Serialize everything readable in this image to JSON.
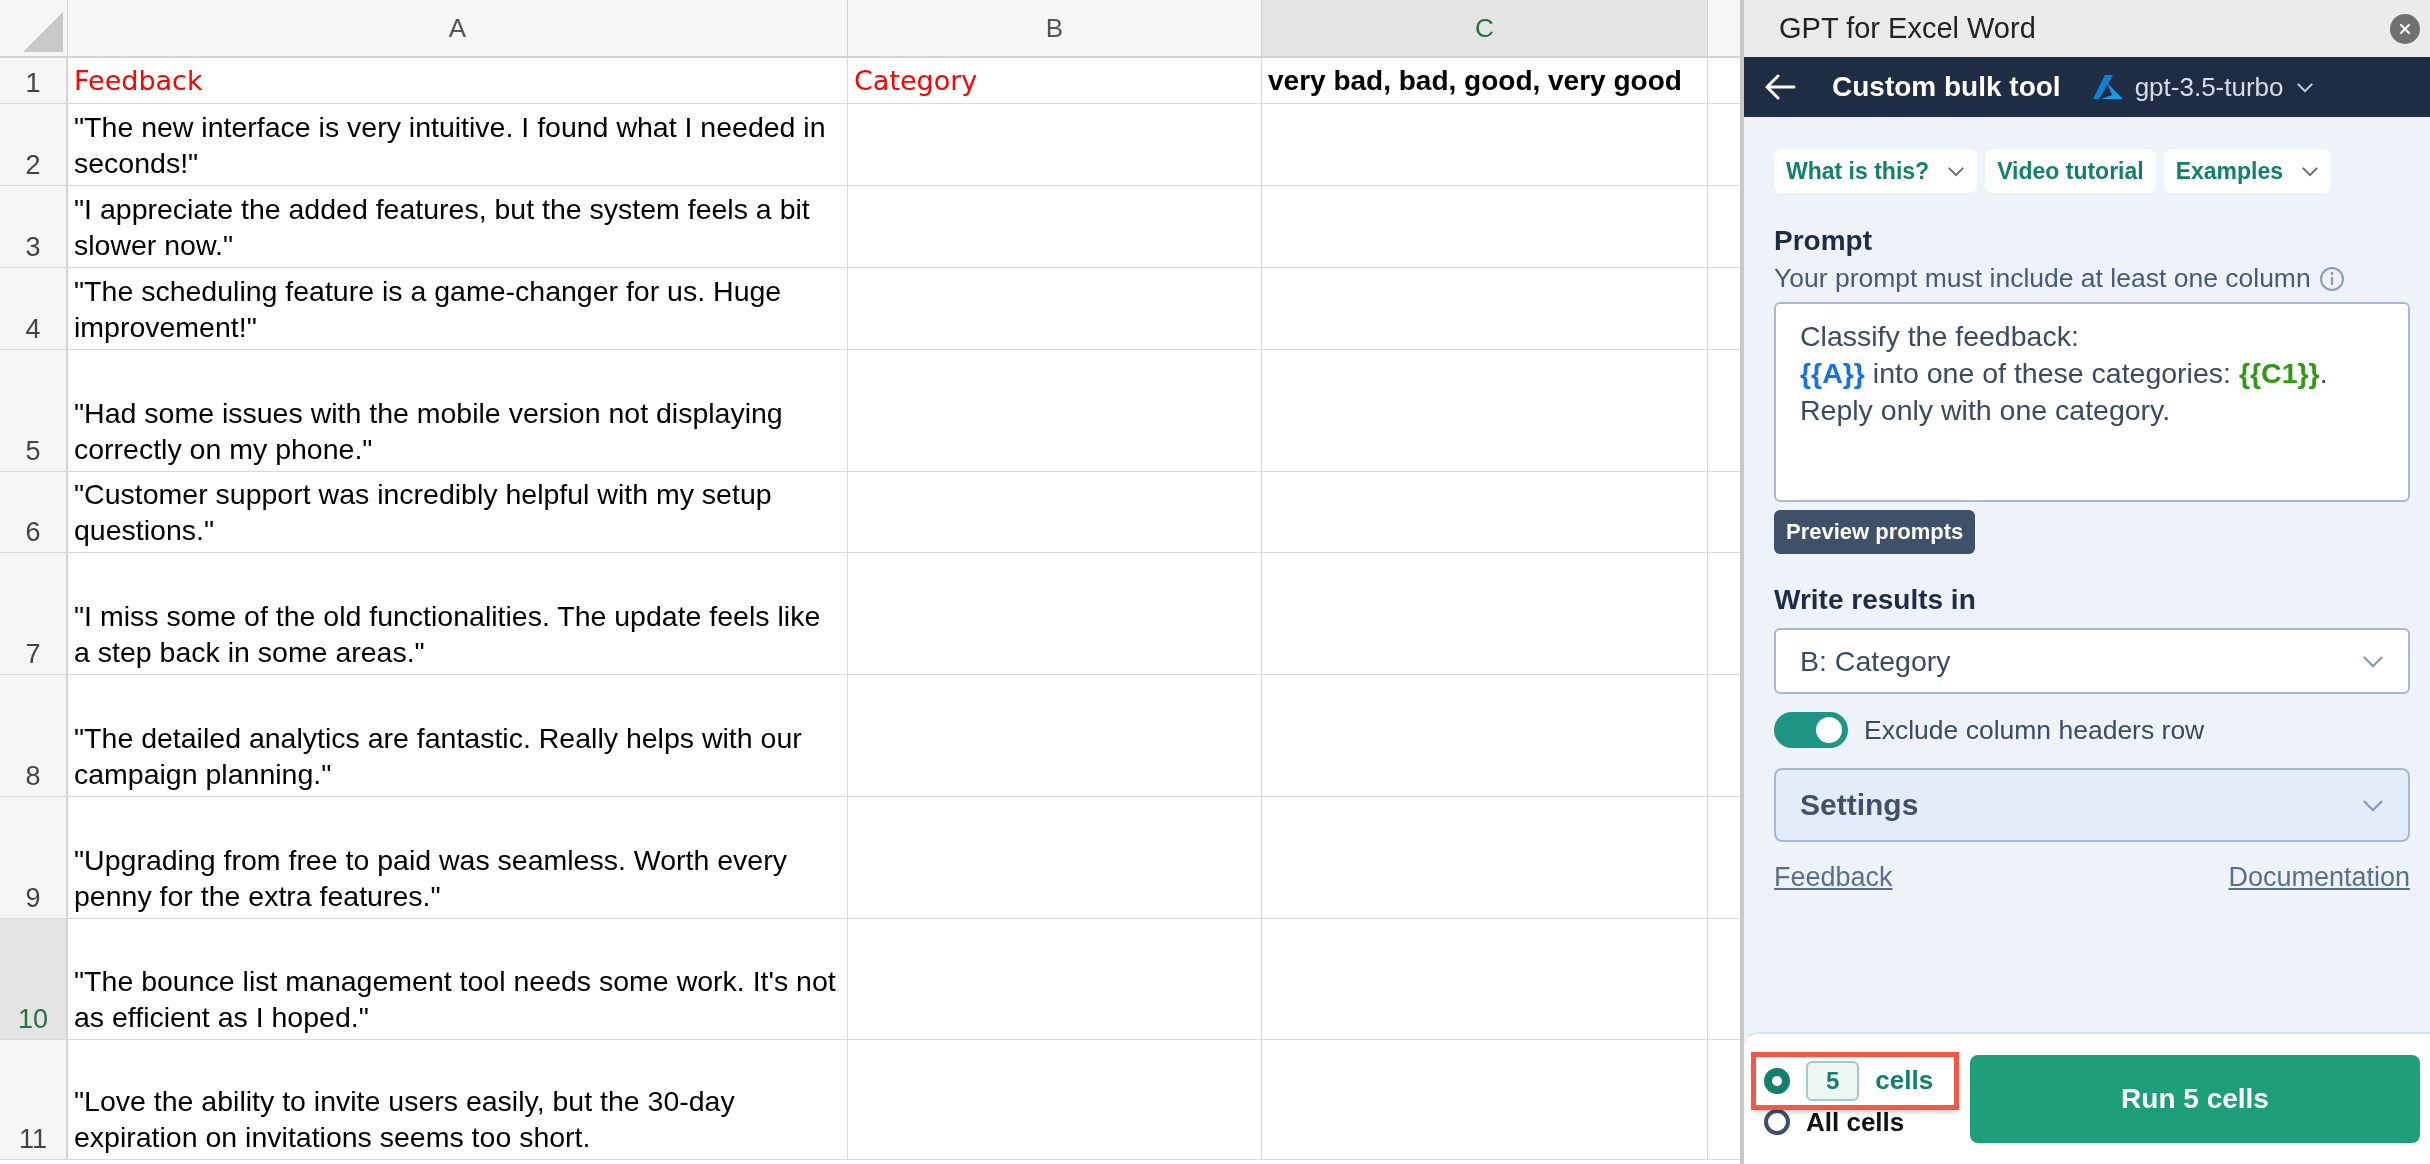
{
  "sheet": {
    "columns": [
      {
        "label": "A",
        "selected": false
      },
      {
        "label": "B",
        "selected": false
      },
      {
        "label": "C",
        "selected": true
      }
    ],
    "rows": [
      {
        "number": "1",
        "selected": false,
        "cells": [
          {
            "text": "Feedback",
            "kind": "heading"
          },
          {
            "text": "Category",
            "kind": "heading"
          },
          {
            "text": "very bad, bad, good, very good",
            "kind": "bold"
          }
        ]
      },
      {
        "number": "2",
        "selected": false,
        "cells": [
          {
            "text": "\"The new interface is very intuitive. I found what I needed in seconds!\"",
            "kind": "plain"
          }
        ]
      },
      {
        "number": "3",
        "selected": false,
        "cells": [
          {
            "text": "\"I appreciate the added features, but the system feels a bit slower now.\"",
            "kind": "plain"
          }
        ]
      },
      {
        "number": "4",
        "selected": false,
        "cells": [
          {
            "text": "\"The scheduling feature is a game-changer for us. Huge improvement!\"",
            "kind": "plain"
          }
        ]
      },
      {
        "number": "5",
        "selected": false,
        "cells": [
          {
            "text": "\"Had some issues with the mobile version not displaying correctly on my phone.\"",
            "kind": "plain"
          }
        ]
      },
      {
        "number": "6",
        "selected": false,
        "cells": [
          {
            "text": "\"Customer support was incredibly helpful with my setup questions.\"",
            "kind": "plain"
          }
        ]
      },
      {
        "number": "7",
        "selected": false,
        "cells": [
          {
            "text": "\"I miss some of the old functionalities. The update feels like a step back in some areas.\"",
            "kind": "plain"
          }
        ]
      },
      {
        "number": "8",
        "selected": false,
        "cells": [
          {
            "text": "\"The detailed analytics are fantastic. Really helps with our campaign planning.\"",
            "kind": "plain"
          }
        ]
      },
      {
        "number": "9",
        "selected": false,
        "cells": [
          {
            "text": "\"Upgrading from free to paid was seamless. Worth every penny for the extra features.\"",
            "kind": "plain"
          }
        ]
      },
      {
        "number": "10",
        "selected": true,
        "cells": [
          {
            "text": "\"The bounce list management tool needs some work. It's not as efficient as I hoped.\"",
            "kind": "plain"
          }
        ]
      },
      {
        "number": "11",
        "selected": false,
        "cells": [
          {
            "text": "\"Love the ability to invite users easily, but the 30-day expiration on invitations seems too short.",
            "kind": "plain"
          }
        ]
      }
    ]
  },
  "panel": {
    "title": "GPT for Excel Word",
    "header": {
      "title": "Custom bulk tool",
      "model": "gpt-3.5-turbo"
    },
    "chips": [
      {
        "label": "What is this?",
        "dropdown": true
      },
      {
        "label": "Video tutorial",
        "dropdown": false
      },
      {
        "label": "Examples",
        "dropdown": true
      }
    ],
    "prompt": {
      "label": "Prompt",
      "hint": "Your prompt must include at least one column",
      "lines": [
        [
          {
            "text": "Classify the feedback:",
            "kind": "text"
          }
        ],
        [
          {
            "text": "{{A}}",
            "kind": "column"
          },
          {
            "text": " into one of these categories: ",
            "kind": "text"
          },
          {
            "text": "{{C1}}",
            "kind": "cell"
          },
          {
            "text": ".",
            "kind": "text"
          }
        ],
        [
          {
            "text": "Reply only with one category.",
            "kind": "text"
          }
        ]
      ]
    },
    "preview_button": "Preview prompts",
    "results": {
      "label": "Write results in",
      "value": "B: Category"
    },
    "exclude_headers": {
      "label": "Exclude column headers row",
      "on": true
    },
    "settings": {
      "label": "Settings",
      "expanded": false
    },
    "links": [
      "Feedback",
      "Documentation"
    ],
    "run_options": [
      {
        "kind": "count",
        "count": "5",
        "label": "cells",
        "selected": true,
        "highlighted": true
      },
      {
        "kind": "all",
        "label": "All cells",
        "selected": false,
        "highlighted": false
      }
    ],
    "run_button": "Run 5 cells"
  }
}
